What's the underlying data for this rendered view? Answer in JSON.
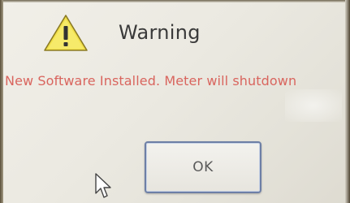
{
  "dialog": {
    "title": "Warning",
    "message": "New Software Installed. Meter will shutdown",
    "ok_label": "OK"
  },
  "icons": {
    "warning": "warning-icon",
    "cursor": "mouse-cursor-icon"
  },
  "colors": {
    "message": "#d9655e",
    "warning_fill": "#f2e04a",
    "button_border": "#6d7fa6"
  }
}
